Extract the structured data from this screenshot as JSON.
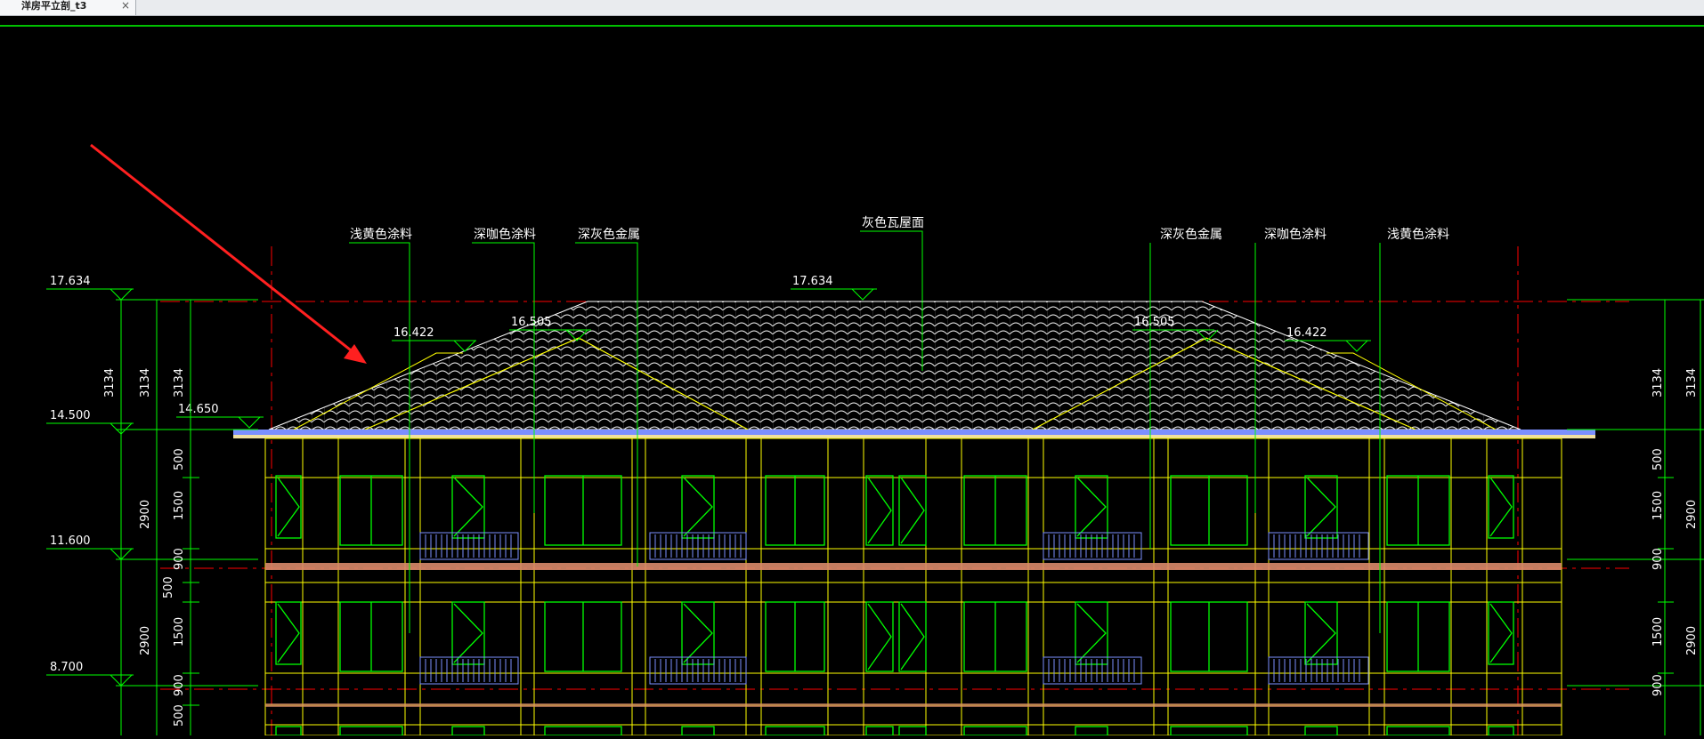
{
  "tab": {
    "title": "洋房平立剖_t3",
    "close_glyph": "×"
  },
  "colors": {
    "background": "#000000",
    "dimension": "#00ff00",
    "outline": "#ffff00",
    "window": "#00ff00",
    "roof_tile": "#ffffff",
    "axis": "#ff0000",
    "annotation_arrow": "#ff2020",
    "balcony_rail": "#7b8fff"
  },
  "material_labels": {
    "left": [
      "浅黄色涂料",
      "深咖色涂料",
      "深灰色金属"
    ],
    "center": "灰色瓦屋面",
    "right": [
      "深灰色金属",
      "深咖色涂料",
      "浅黄色涂料"
    ]
  },
  "elevations": {
    "left_column": [
      "17.634",
      "14.500",
      "11.600",
      "8.700"
    ],
    "roof": [
      "16.422",
      "16.505",
      "17.634",
      "16.505",
      "16.422"
    ],
    "eave": "14.650"
  },
  "dimensions": {
    "left_outer": [
      "3134",
      "3134",
      "3134",
      "2900",
      "2900"
    ],
    "left_inner": [
      "500",
      "1500",
      "900",
      "500",
      "1500",
      "900",
      "500"
    ],
    "right_inner": [
      "3134",
      "500",
      "1500",
      "900",
      "1500",
      "900"
    ],
    "right_outer": [
      "3134",
      "2900",
      "2900"
    ]
  }
}
